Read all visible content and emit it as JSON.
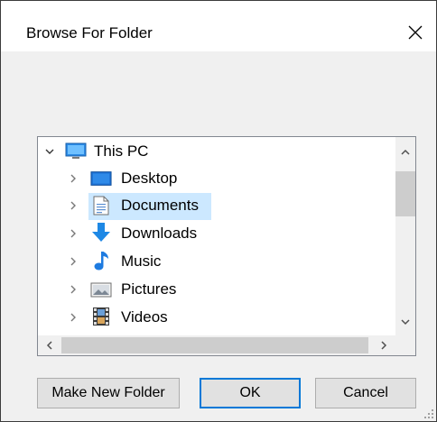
{
  "window": {
    "title": "Browse For Folder",
    "close_glyph": "✕"
  },
  "tree": {
    "root": {
      "label": "This PC",
      "icon": "computer-icon",
      "expanded": true
    },
    "items": [
      {
        "label": "Desktop",
        "icon": "desktop-icon",
        "selected": false
      },
      {
        "label": "Documents",
        "icon": "documents-icon",
        "selected": true
      },
      {
        "label": "Downloads",
        "icon": "downloads-icon",
        "selected": false
      },
      {
        "label": "Music",
        "icon": "music-icon",
        "selected": false
      },
      {
        "label": "Pictures",
        "icon": "pictures-icon",
        "selected": false
      },
      {
        "label": "Videos",
        "icon": "videos-icon",
        "selected": false
      }
    ]
  },
  "buttons": {
    "make_new_folder": "Make New Folder",
    "ok": "OK",
    "cancel": "Cancel"
  },
  "colors": {
    "selection": "#cce8ff",
    "accent": "#0078d7",
    "downloads_blue": "#1e88e5",
    "music_blue": "#1e7be0"
  }
}
